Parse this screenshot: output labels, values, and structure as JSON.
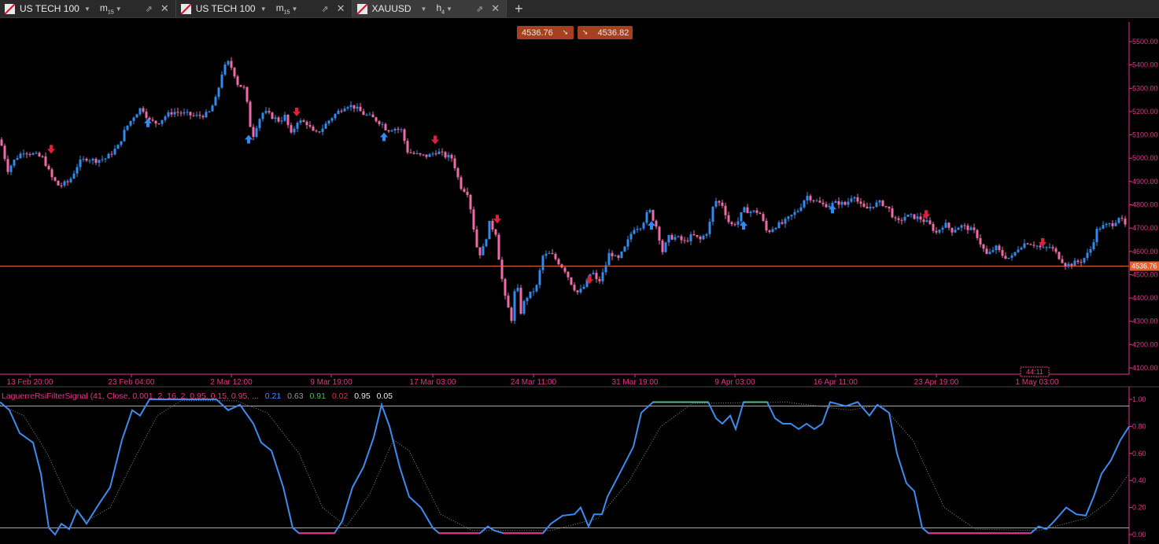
{
  "tabs": [
    {
      "symbol": "US TECH 100",
      "timeframe": "m",
      "timeframe_sub": "15",
      "active": false
    },
    {
      "symbol": "US TECH 100",
      "timeframe": "m",
      "timeframe_sub": "15",
      "active": false
    },
    {
      "symbol": "XAUUSD",
      "timeframe": "h",
      "timeframe_sub": "4",
      "active": true
    }
  ],
  "add_tab_label": "+",
  "quote": {
    "bid": "4536.76",
    "ask": "4536.82"
  },
  "colors": {
    "bull": "#2f8bf0",
    "bear": "#f06aa8",
    "axis": "#e0358a",
    "price_line": "#e06030",
    "buy_arrow": "#2f8bf0",
    "sell_arrow": "#e0203a",
    "osc": "#3a8cf0",
    "osc_signal": "#888888",
    "osc_overbought": "#4bbf86",
    "osc_oversold": "#e0358a"
  },
  "price_axis": {
    "ticks": [
      "5500.00",
      "5400.00",
      "5300.00",
      "5200.00",
      "5100.00",
      "5000.00",
      "4900.00",
      "4800.00",
      "4700.00",
      "4600.00",
      "4500.00",
      "4400.00",
      "4300.00",
      "4200.00",
      "4100.00"
    ],
    "current": "4536.76"
  },
  "time_axis": {
    "labels": [
      "13 Feb 20:00",
      "23 Feb 04:00",
      "2 Mar 12:00",
      "9 Mar 19:00",
      "17 Mar 03:00",
      "24 Mar 11:00",
      "31 Mar 19:00",
      "9 Apr 03:00",
      "16 Apr 11:00",
      "23 Apr 19:00",
      "1 May 03:00"
    ],
    "countdown": "44:11"
  },
  "indicator": {
    "name": "LaguerreRsiFilterSignal (41, Close, 0.001, 2, 16, 2, 0.95, 0.15, 0.95, ...",
    "values": [
      "0.21",
      "0.63",
      "0.91",
      "0.02",
      "0.95",
      "0.05"
    ],
    "axis_ticks": [
      "1.00",
      "0.80",
      "0.60",
      "0.40",
      "0.20",
      "0.00"
    ],
    "upper_level": 0.95,
    "lower_level": 0.05
  },
  "chart_data": {
    "type": "candlestick",
    "symbol": "XAUUSD",
    "timeframe": "h4",
    "ylim": [
      4080,
      5560
    ],
    "close_path": [
      [
        0,
        5080
      ],
      [
        10,
        4950
      ],
      [
        20,
        5000
      ],
      [
        30,
        5030
      ],
      [
        40,
        5020
      ],
      [
        55,
        5000
      ],
      [
        65,
        4920
      ],
      [
        75,
        4880
      ],
      [
        88,
        4900
      ],
      [
        100,
        4980
      ],
      [
        110,
        5000
      ],
      [
        120,
        4990
      ],
      [
        135,
        5000
      ],
      [
        150,
        5050
      ],
      [
        160,
        5130
      ],
      [
        170,
        5180
      ],
      [
        180,
        5220
      ],
      [
        190,
        5160
      ],
      [
        200,
        5150
      ],
      [
        210,
        5180
      ],
      [
        220,
        5200
      ],
      [
        235,
        5190
      ],
      [
        250,
        5180
      ],
      [
        265,
        5190
      ],
      [
        275,
        5260
      ],
      [
        283,
        5380
      ],
      [
        290,
        5410
      ],
      [
        296,
        5380
      ],
      [
        302,
        5320
      ],
      [
        310,
        5300
      ],
      [
        316,
        5200
      ],
      [
        320,
        5080
      ],
      [
        328,
        5160
      ],
      [
        335,
        5200
      ],
      [
        345,
        5180
      ],
      [
        355,
        5160
      ],
      [
        362,
        5180
      ],
      [
        370,
        5100
      ],
      [
        378,
        5160
      ],
      [
        390,
        5150
      ],
      [
        400,
        5100
      ],
      [
        410,
        5130
      ],
      [
        420,
        5170
      ],
      [
        430,
        5200
      ],
      [
        440,
        5230
      ],
      [
        450,
        5220
      ],
      [
        462,
        5190
      ],
      [
        475,
        5170
      ],
      [
        485,
        5150
      ],
      [
        492,
        5120
      ],
      [
        500,
        5130
      ],
      [
        510,
        5120
      ],
      [
        518,
        5030
      ],
      [
        525,
        5020
      ],
      [
        535,
        5010
      ],
      [
        545,
        5010
      ],
      [
        555,
        5030
      ],
      [
        565,
        5010
      ],
      [
        575,
        5000
      ],
      [
        585,
        4880
      ],
      [
        595,
        4850
      ],
      [
        602,
        4700
      ],
      [
        608,
        4580
      ],
      [
        615,
        4620
      ],
      [
        622,
        4720
      ],
      [
        630,
        4680
      ],
      [
        636,
        4520
      ],
      [
        642,
        4400
      ],
      [
        650,
        4310
      ],
      [
        656,
        4480
      ],
      [
        662,
        4340
      ],
      [
        668,
        4400
      ],
      [
        675,
        4420
      ],
      [
        682,
        4450
      ],
      [
        690,
        4580
      ],
      [
        700,
        4590
      ],
      [
        708,
        4560
      ],
      [
        718,
        4520
      ],
      [
        728,
        4450
      ],
      [
        735,
        4420
      ],
      [
        745,
        4460
      ],
      [
        752,
        4520
      ],
      [
        760,
        4460
      ],
      [
        768,
        4520
      ],
      [
        775,
        4600
      ],
      [
        785,
        4560
      ],
      [
        795,
        4620
      ],
      [
        805,
        4700
      ],
      [
        815,
        4710
      ],
      [
        825,
        4780
      ],
      [
        835,
        4700
      ],
      [
        842,
        4600
      ],
      [
        850,
        4660
      ],
      [
        860,
        4660
      ],
      [
        870,
        4640
      ],
      [
        880,
        4670
      ],
      [
        890,
        4650
      ],
      [
        900,
        4690
      ],
      [
        908,
        4820
      ],
      [
        918,
        4800
      ],
      [
        928,
        4710
      ],
      [
        938,
        4730
      ],
      [
        945,
        4780
      ],
      [
        955,
        4770
      ],
      [
        965,
        4770
      ],
      [
        975,
        4680
      ],
      [
        985,
        4710
      ],
      [
        995,
        4720
      ],
      [
        1005,
        4750
      ],
      [
        1015,
        4780
      ],
      [
        1025,
        4840
      ],
      [
        1035,
        4820
      ],
      [
        1045,
        4800
      ],
      [
        1055,
        4800
      ],
      [
        1065,
        4810
      ],
      [
        1075,
        4800
      ],
      [
        1085,
        4850
      ],
      [
        1092,
        4800
      ],
      [
        1100,
        4780
      ],
      [
        1110,
        4800
      ],
      [
        1120,
        4810
      ],
      [
        1130,
        4780
      ],
      [
        1140,
        4720
      ],
      [
        1150,
        4750
      ],
      [
        1160,
        4750
      ],
      [
        1170,
        4740
      ],
      [
        1180,
        4720
      ],
      [
        1190,
        4680
      ],
      [
        1200,
        4720
      ],
      [
        1210,
        4690
      ],
      [
        1220,
        4710
      ],
      [
        1230,
        4700
      ],
      [
        1240,
        4680
      ],
      [
        1248,
        4620
      ],
      [
        1255,
        4580
      ],
      [
        1265,
        4620
      ],
      [
        1275,
        4580
      ],
      [
        1285,
        4570
      ],
      [
        1295,
        4620
      ],
      [
        1305,
        4640
      ],
      [
        1315,
        4630
      ],
      [
        1325,
        4610
      ],
      [
        1335,
        4620
      ],
      [
        1345,
        4580
      ],
      [
        1355,
        4540
      ],
      [
        1365,
        4550
      ],
      [
        1375,
        4560
      ],
      [
        1385,
        4600
      ],
      [
        1395,
        4700
      ],
      [
        1405,
        4710
      ],
      [
        1415,
        4720
      ],
      [
        1422,
        4750
      ],
      [
        1432,
        4700
      ]
    ],
    "buy_signals": [
      [
        188,
        5150
      ],
      [
        316,
        5080
      ],
      [
        488,
        5090
      ],
      [
        828,
        4710
      ],
      [
        945,
        4710
      ],
      [
        1058,
        4780
      ]
    ],
    "sell_signals": [
      [
        65,
        5040
      ],
      [
        377,
        5200
      ],
      [
        553,
        5080
      ],
      [
        632,
        4740
      ],
      [
        749,
        4480
      ],
      [
        1177,
        4760
      ],
      [
        1325,
        4640
      ]
    ],
    "oscillator": {
      "main": [
        [
          0,
          0.98
        ],
        [
          12,
          0.92
        ],
        [
          25,
          0.75
        ],
        [
          42,
          0.68
        ],
        [
          52,
          0.45
        ],
        [
          62,
          0.05
        ],
        [
          70,
          0.0
        ],
        [
          78,
          0.08
        ],
        [
          88,
          0.04
        ],
        [
          98,
          0.18
        ],
        [
          110,
          0.08
        ],
        [
          125,
          0.22
        ],
        [
          140,
          0.35
        ],
        [
          155,
          0.7
        ],
        [
          168,
          0.92
        ],
        [
          178,
          0.88
        ],
        [
          190,
          1.0
        ],
        [
          250,
          1.0
        ],
        [
          275,
          1.0
        ],
        [
          290,
          0.92
        ],
        [
          305,
          0.96
        ],
        [
          322,
          0.82
        ],
        [
          332,
          0.68
        ],
        [
          345,
          0.62
        ],
        [
          360,
          0.35
        ],
        [
          372,
          0.05
        ],
        [
          380,
          0.01
        ],
        [
          425,
          0.01
        ],
        [
          435,
          0.1
        ],
        [
          448,
          0.35
        ],
        [
          462,
          0.5
        ],
        [
          475,
          0.72
        ],
        [
          485,
          0.96
        ],
        [
          495,
          0.8
        ],
        [
          508,
          0.5
        ],
        [
          520,
          0.28
        ],
        [
          535,
          0.2
        ],
        [
          550,
          0.05
        ],
        [
          558,
          0.01
        ],
        [
          610,
          0.01
        ],
        [
          620,
          0.06
        ],
        [
          628,
          0.03
        ],
        [
          640,
          0.01
        ],
        [
          690,
          0.01
        ],
        [
          700,
          0.08
        ],
        [
          715,
          0.14
        ],
        [
          730,
          0.15
        ],
        [
          738,
          0.2
        ],
        [
          748,
          0.06
        ],
        [
          755,
          0.15
        ],
        [
          765,
          0.15
        ],
        [
          772,
          0.28
        ],
        [
          790,
          0.48
        ],
        [
          805,
          0.65
        ],
        [
          815,
          0.9
        ],
        [
          830,
          0.98
        ],
        [
          900,
          0.98
        ],
        [
          910,
          0.86
        ],
        [
          918,
          0.82
        ],
        [
          928,
          0.88
        ],
        [
          935,
          0.78
        ],
        [
          945,
          0.98
        ],
        [
          975,
          0.98
        ],
        [
          985,
          0.86
        ],
        [
          995,
          0.82
        ],
        [
          1005,
          0.82
        ],
        [
          1015,
          0.78
        ],
        [
          1025,
          0.82
        ],
        [
          1035,
          0.78
        ],
        [
          1045,
          0.82
        ],
        [
          1055,
          0.98
        ],
        [
          1075,
          0.95
        ],
        [
          1090,
          0.98
        ],
        [
          1105,
          0.88
        ],
        [
          1115,
          0.96
        ],
        [
          1130,
          0.9
        ],
        [
          1140,
          0.6
        ],
        [
          1152,
          0.38
        ],
        [
          1162,
          0.32
        ],
        [
          1172,
          0.05
        ],
        [
          1180,
          0.01
        ],
        [
          1310,
          0.01
        ],
        [
          1320,
          0.06
        ],
        [
          1330,
          0.04
        ],
        [
          1340,
          0.1
        ],
        [
          1355,
          0.2
        ],
        [
          1368,
          0.15
        ],
        [
          1380,
          0.14
        ],
        [
          1390,
          0.28
        ],
        [
          1400,
          0.45
        ],
        [
          1412,
          0.55
        ],
        [
          1424,
          0.7
        ],
        [
          1435,
          0.8
        ]
      ],
      "signal": [
        [
          0,
          0.96
        ],
        [
          30,
          0.88
        ],
        [
          60,
          0.6
        ],
        [
          90,
          0.22
        ],
        [
          110,
          0.1
        ],
        [
          140,
          0.2
        ],
        [
          170,
          0.55
        ],
        [
          200,
          0.88
        ],
        [
          230,
          0.99
        ],
        [
          300,
          0.99
        ],
        [
          340,
          0.9
        ],
        [
          380,
          0.6
        ],
        [
          410,
          0.2
        ],
        [
          440,
          0.06
        ],
        [
          470,
          0.3
        ],
        [
          500,
          0.7
        ],
        [
          520,
          0.62
        ],
        [
          560,
          0.15
        ],
        [
          600,
          0.03
        ],
        [
          700,
          0.03
        ],
        [
          760,
          0.12
        ],
        [
          800,
          0.4
        ],
        [
          840,
          0.8
        ],
        [
          880,
          0.97
        ],
        [
          1000,
          0.98
        ],
        [
          1080,
          0.92
        ],
        [
          1120,
          0.96
        ],
        [
          1160,
          0.7
        ],
        [
          1200,
          0.2
        ],
        [
          1240,
          0.04
        ],
        [
          1320,
          0.03
        ],
        [
          1380,
          0.12
        ],
        [
          1410,
          0.25
        ],
        [
          1435,
          0.45
        ]
      ]
    }
  }
}
